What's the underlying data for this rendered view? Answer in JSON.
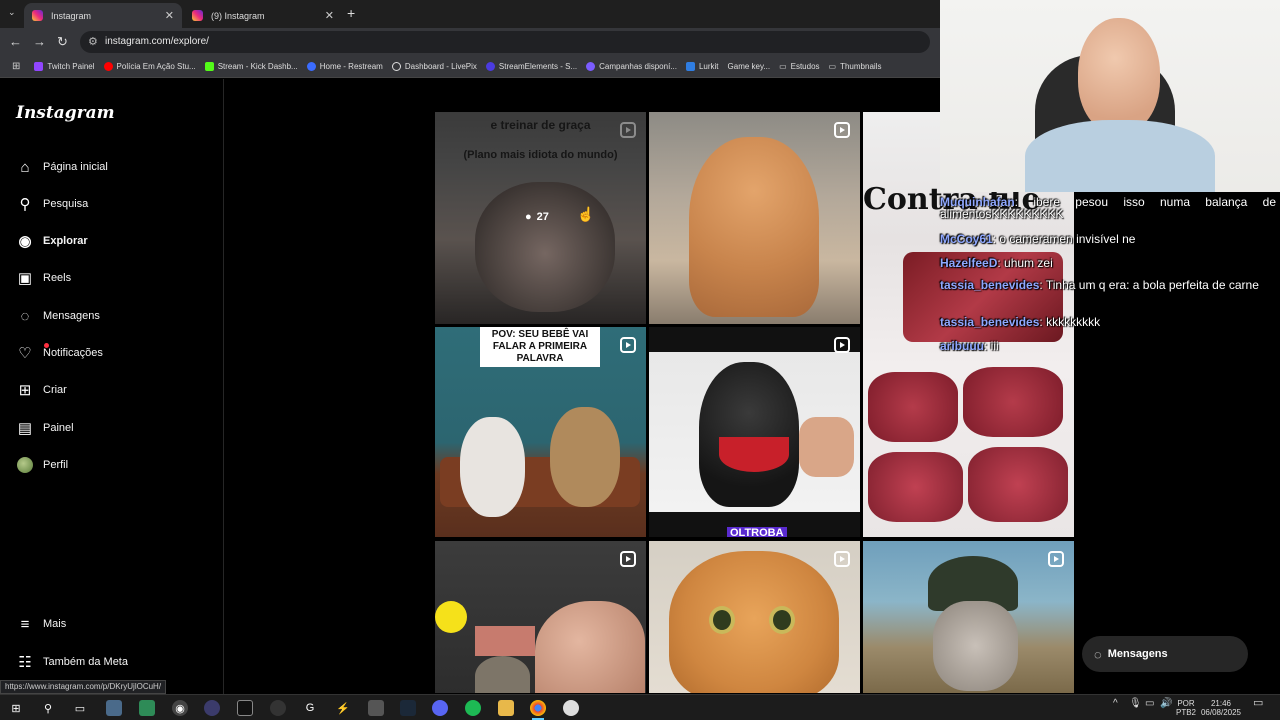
{
  "browser": {
    "tabs": [
      {
        "label": "Instagram",
        "active": true
      },
      {
        "label": "(9) Instagram",
        "active": false
      }
    ],
    "url": "instagram.com/explore/",
    "bookmarks": [
      "Twitch Painel",
      "Polícia Em Ação Stu...",
      "Stream - Kick Dashb...",
      "Home - Restream",
      "Dashboard - LivePix",
      "StreamElements - S...",
      "Campanhas disponí...",
      "Lurkit",
      "Game key...",
      "Estudos",
      "Thumbnails"
    ],
    "status_url": "https://www.instagram.com/p/DKryUjlOCuH/"
  },
  "sidebar": {
    "logo": "Instagram",
    "items": [
      {
        "label": "Página inicial",
        "icon": "home-icon"
      },
      {
        "label": "Pesquisa",
        "icon": "search-icon"
      },
      {
        "label": "Explorar",
        "icon": "compass-icon"
      },
      {
        "label": "Reels",
        "icon": "reels-icon"
      },
      {
        "label": "Mensagens",
        "icon": "messenger-icon"
      },
      {
        "label": "Notificações",
        "icon": "heart-icon"
      },
      {
        "label": "Criar",
        "icon": "plus-square-icon"
      },
      {
        "label": "Painel",
        "icon": "dashboard-icon"
      },
      {
        "label": "Perfil",
        "icon": "avatar"
      }
    ],
    "more": "Mais",
    "meta": "Também da Meta"
  },
  "grid": {
    "tile1_caption_top": "e treinar de graça",
    "tile1_caption_bottom": "(Plano mais idiota do mundo)",
    "tile1_comments": "27",
    "tile4_caption": "POV: SEU BEBÊ VAI FALAR A PRIMEIRA PALAVRA",
    "tile5_caption_bottom": "OLTROBA",
    "tile3_caption": "Contra file"
  },
  "chat": [
    {
      "user": "Muquinhafan",
      "text": " ibere pesou isso numa balança de alimentosKKKKKKKKK"
    },
    {
      "user": "McCoy61",
      "text": " o cameramen invisível ne"
    },
    {
      "user": "HazelfeeD",
      "text": " uhum zei"
    },
    {
      "user": "tassia_benevides",
      "text": " Tinha um q era: a bola perfeita de carne"
    },
    {
      "user": "tassia_benevides",
      "text": " kkkkkkkkk"
    },
    {
      "user": "aribuuu",
      "text": " iii"
    }
  ],
  "messages_pill": "Mensagens",
  "taskbar": {
    "lang_top": "POR",
    "lang_bottom": "PTB2",
    "time": "21:46",
    "date": "06/08/2025"
  },
  "colors": {
    "accent": "#0095f6",
    "notification": "#ff3040",
    "chat_user": "#8fa8ff"
  }
}
